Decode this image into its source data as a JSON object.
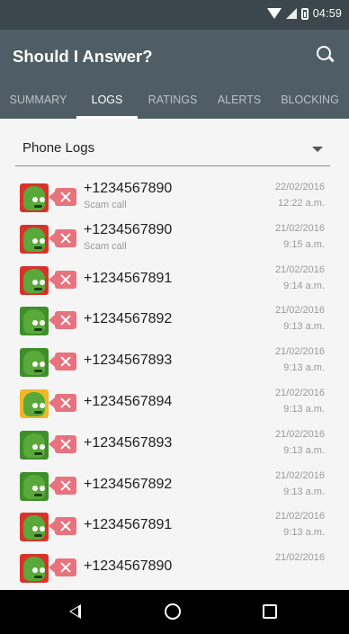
{
  "statusbar": {
    "time": "04:59"
  },
  "appbar": {
    "title": "Should I Answer?"
  },
  "tabs": [
    "SUMMARY",
    "LOGS",
    "RATINGS",
    "ALERTS",
    "BLOCKING"
  ],
  "active_tab": "LOGS",
  "filter": {
    "selected": "Phone Logs"
  },
  "logs": [
    {
      "number": "+1234567890",
      "label": "Scam call",
      "date": "22/02/2016",
      "time": "12:22 a.m.",
      "rating": "red"
    },
    {
      "number": "+1234567890",
      "label": "Scam call",
      "date": "21/02/2016",
      "time": "9:15 a.m.",
      "rating": "red"
    },
    {
      "number": "+1234567891",
      "label": "",
      "date": "21/02/2016",
      "time": "9:14 a.m.",
      "rating": "red"
    },
    {
      "number": "+1234567892",
      "label": "",
      "date": "21/02/2016",
      "time": "9:13 a.m.",
      "rating": "green"
    },
    {
      "number": "+1234567893",
      "label": "",
      "date": "21/02/2016",
      "time": "9:13 a.m.",
      "rating": "green"
    },
    {
      "number": "+1234567894",
      "label": "",
      "date": "21/02/2016",
      "time": "9:13 a.m.",
      "rating": "yellow"
    },
    {
      "number": "+1234567893",
      "label": "",
      "date": "21/02/2016",
      "time": "9:13 a.m.",
      "rating": "green"
    },
    {
      "number": "+1234567892",
      "label": "",
      "date": "21/02/2016",
      "time": "9:13 a.m.",
      "rating": "green"
    },
    {
      "number": "+1234567891",
      "label": "",
      "date": "21/02/2016",
      "time": "9:13 a.m.",
      "rating": "red"
    },
    {
      "number": "+1234567890",
      "label": "",
      "date": "21/02/2016",
      "time": "",
      "rating": "red"
    }
  ],
  "icons": {
    "search": "search-icon",
    "dropdown": "chevron-down-icon",
    "call_status": "rejected-call-icon",
    "nav_back": "back-icon",
    "nav_home": "home-icon",
    "nav_recents": "recents-icon"
  },
  "colors": {
    "toolbar": "#4f5e65",
    "statusbar": "#3b474c",
    "rating_red": "#d8332a",
    "rating_green": "#3e8f2a",
    "rating_yellow": "#f0b825",
    "missed_call": "#e7737e"
  }
}
